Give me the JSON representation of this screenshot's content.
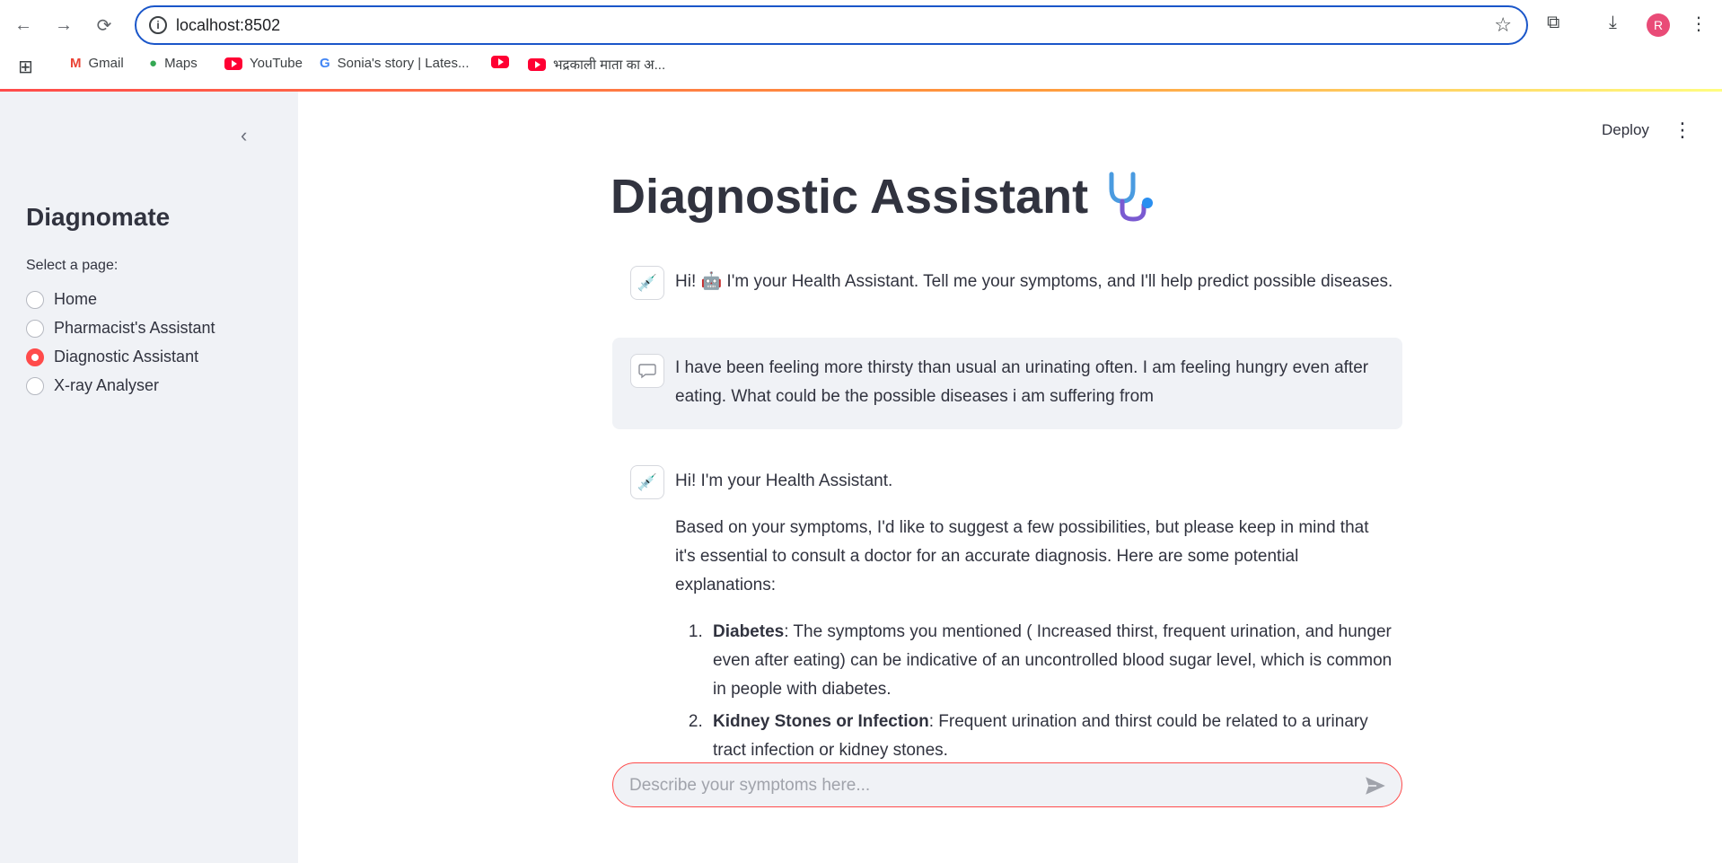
{
  "browser": {
    "url": "localhost:8502",
    "bookmarks": [
      {
        "label": "Gmail"
      },
      {
        "label": "Maps"
      },
      {
        "label": "YouTube"
      },
      {
        "label": "Sonia's story | Lates..."
      },
      {
        "label": ""
      },
      {
        "label": "भद्रकाली माता का अ..."
      }
    ],
    "profile_initial": "R"
  },
  "sidebar": {
    "brand": "Diagnomate",
    "select_label": "Select a page:",
    "pages": [
      {
        "label": "Home",
        "selected": false
      },
      {
        "label": "Pharmacist's Assistant",
        "selected": false
      },
      {
        "label": "Diagnostic Assistant",
        "selected": true
      },
      {
        "label": "X-ray Analyser",
        "selected": false
      }
    ]
  },
  "header": {
    "deploy_label": "Deploy"
  },
  "main": {
    "title": "Diagnostic Assistant",
    "messages": [
      {
        "role": "assistant",
        "text": "Hi! 🤖 I'm your Health Assistant. Tell me your symptoms, and I'll help predict possible diseases."
      },
      {
        "role": "user",
        "text": "I have been feeling more thirsty than usual an urinating often. I am feeling hungry even after eating. What could be the possible diseases i am suffering from"
      },
      {
        "role": "assistant",
        "greeting": "Hi! I'm your Health Assistant.",
        "intro": "Based on your symptoms, I'd like to suggest a few possibilities, but please keep in mind that it's essential to consult a doctor for an accurate diagnosis. Here are some potential explanations:",
        "items": [
          {
            "title": "Diabetes",
            "text": ": The symptoms you mentioned ( Increased thirst, frequent urination, and hunger even after eating) can be indicative of an uncontrolled blood sugar level, which is common in people with diabetes."
          },
          {
            "title": "Kidney Stones or Infection",
            "text": ": Frequent urination and thirst could be related to a urinary tract infection or kidney stones."
          }
        ]
      }
    ],
    "input_placeholder": "Describe your symptoms here..."
  },
  "colors": {
    "accent": "#ff4b4b",
    "sidebar_bg": "#f0f2f6",
    "omnibox_border": "#1a56c9"
  }
}
